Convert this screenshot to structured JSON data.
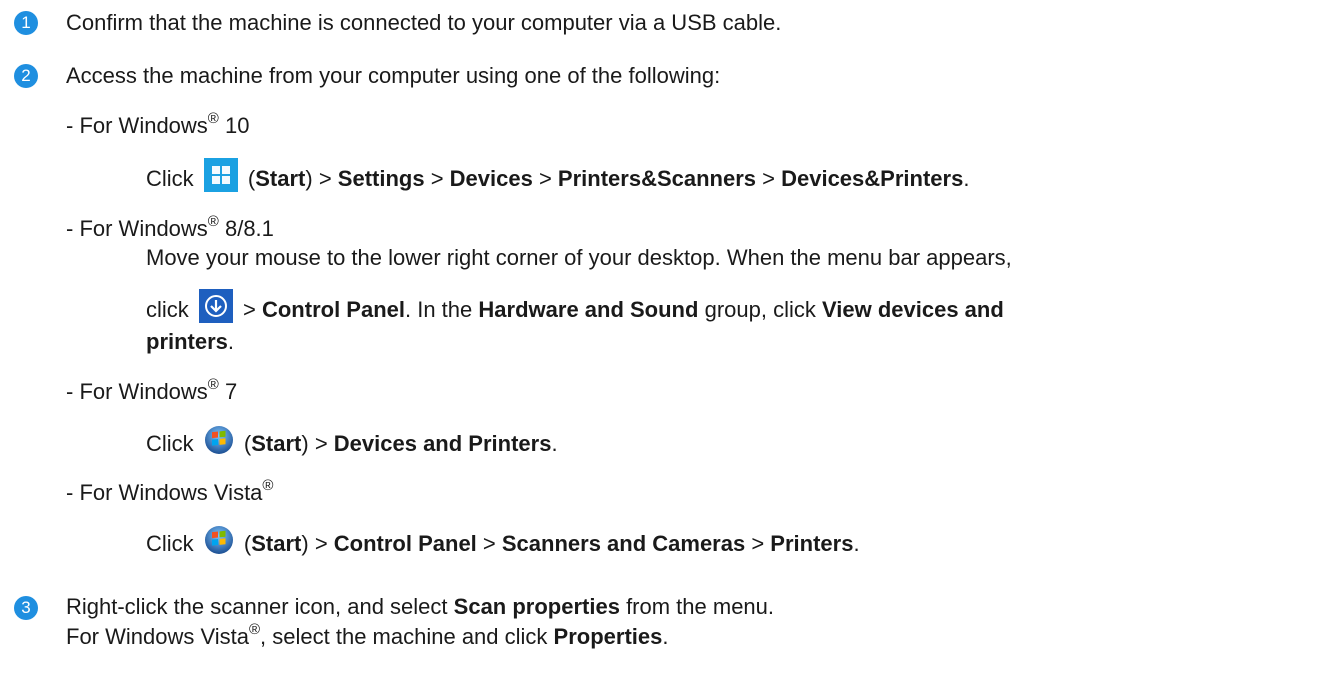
{
  "steps": [
    {
      "number": "1",
      "text": "Confirm that the machine is connected to your computer via a USB cable."
    },
    {
      "number": "2",
      "text": "Access the machine from your computer using one of the following:"
    },
    {
      "number": "3"
    }
  ],
  "win10": {
    "label": "- For Windows",
    "reg": "®",
    "version": " 10",
    "click": "Click",
    "start": "Start",
    "settings": "Settings",
    "devices": "Devices",
    "printers_scanners": "Printers&Scanners",
    "devices_printers": "Devices&Printers"
  },
  "win8": {
    "label": "- For Windows",
    "reg": "®",
    "version": " 8/8.1",
    "line1": "Move your mouse to the lower right corner of your desktop. When the menu bar appears,",
    "click": "click",
    "control_panel": "Control Panel",
    "in_the": ". In the",
    "hardware_sound": "Hardware and Sound",
    "group_click": "group, click",
    "view_devices": "View devices and",
    "printers": "printers"
  },
  "win7": {
    "label": "- For Windows",
    "reg": "®",
    "version": " 7",
    "click": "Click",
    "start": "Start",
    "devices_printers": "Devices and Printers"
  },
  "vista": {
    "label": "- For Windows Vista",
    "reg": "®",
    "click": "Click",
    "start": "Start",
    "control_panel": "Control Panel",
    "scanners_cameras": "Scanners and Cameras",
    "printers": "Printers"
  },
  "step3": {
    "line1_pre": "Right-click the scanner icon, and select",
    "scan_properties": "Scan properties",
    "line1_post": "from the menu.",
    "line2_pre": "For Windows Vista",
    "reg": "®",
    "line2_mid": ", select the machine and click",
    "properties": "Properties"
  },
  "icons": {
    "win10_start": "windows-10-start-icon",
    "win8_charm": "windows-8-arrow-icon",
    "win7_start": "windows-7-orb-icon",
    "vista_start": "windows-vista-orb-icon"
  },
  "colors": {
    "step_badge": "#1f8fe0",
    "text": "#1a1a1a",
    "win10_tile": "#1ba1e2",
    "win8_tile": "#1e5fbf"
  }
}
